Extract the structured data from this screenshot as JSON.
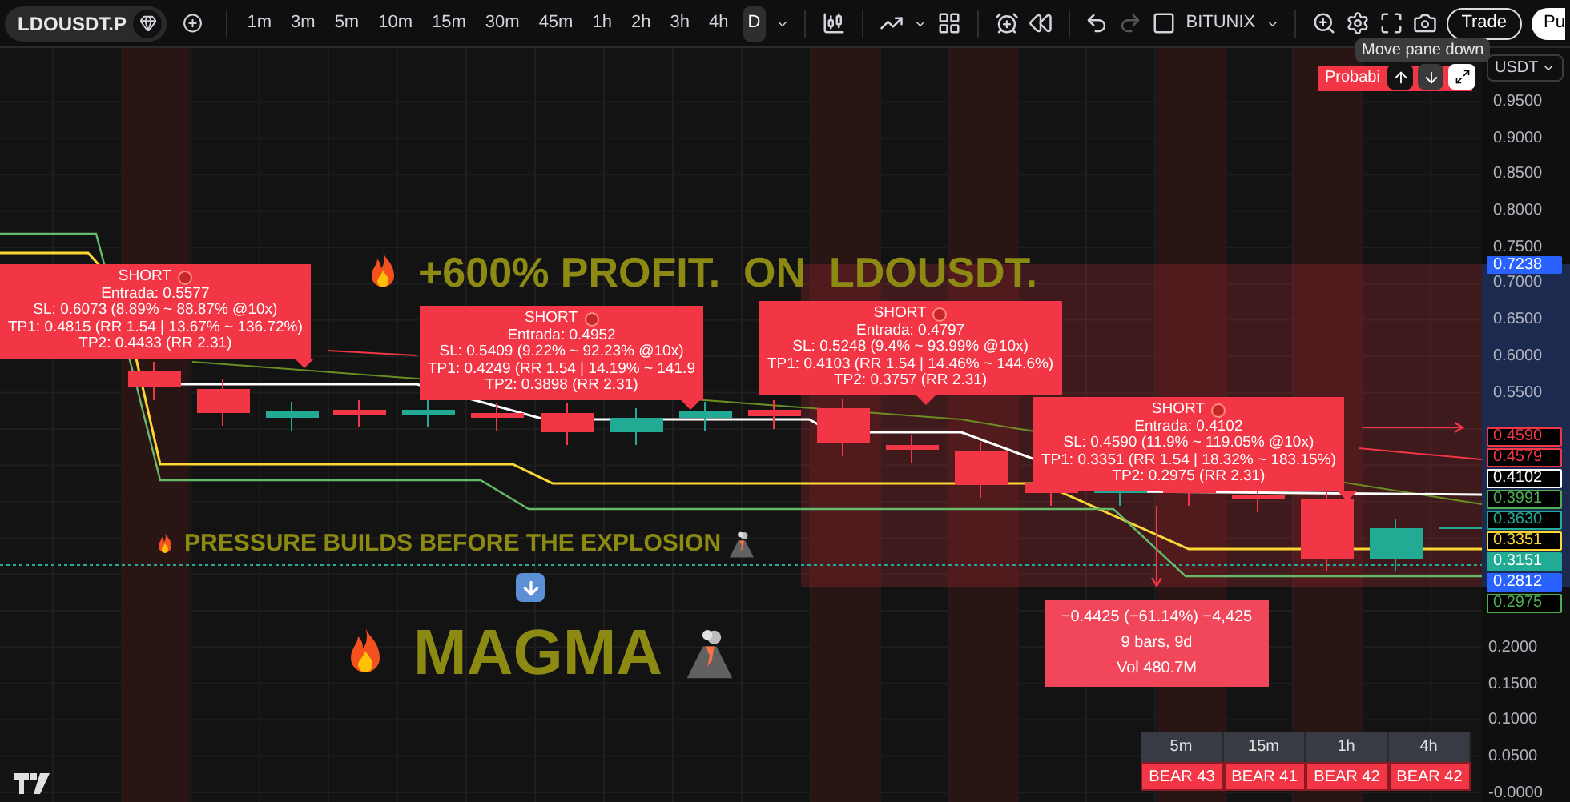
{
  "toolbar": {
    "symbol": "LDOUSDT.P",
    "intervals": [
      {
        "label": "1m",
        "selected": false
      },
      {
        "label": "3m",
        "selected": false
      },
      {
        "label": "5m",
        "selected": false
      },
      {
        "label": "10m",
        "selected": false
      },
      {
        "label": "15m",
        "selected": false
      },
      {
        "label": "30m",
        "selected": false
      },
      {
        "label": "45m",
        "selected": false
      },
      {
        "label": "1h",
        "selected": false
      },
      {
        "label": "2h",
        "selected": false
      },
      {
        "label": "3h",
        "selected": false
      },
      {
        "label": "4h",
        "selected": false
      },
      {
        "label": "D",
        "selected": true
      }
    ],
    "exchange": "BITUNIX",
    "trade_button": "Trade",
    "cut_button": "Pu"
  },
  "tooltip": "Move pane down",
  "pane": {
    "probability_label": "Probabi",
    "currency": "USDT"
  },
  "headline": "+600% PROFIT.  ON  LDOUSDT.",
  "subheadline": "PRESSURE BUILDS BEFORE THE EXPLOSION",
  "magma": "MAGMA",
  "signals": [
    {
      "title": "SHORT",
      "lines": [
        "Entrada: 0.5577",
        "SL: 0.6073 (8.89% ~ 88.87% @10x)",
        "TP1: 0.4815 (RR 1.54 | 13.67% ~ 136.72%)",
        "TP2: 0.4433 (RR 2.31)"
      ]
    },
    {
      "title": "SHORT",
      "lines": [
        "Entrada: 0.4952",
        "SL: 0.5409 (9.22% ~ 92.23% @10x)",
        "TP1: 0.4249 (RR 1.54 | 14.19% ~ 141.9",
        "TP2: 0.3898 (RR 2.31)"
      ]
    },
    {
      "title": "SHORT",
      "lines": [
        "Entrada: 0.4797",
        "SL: 0.5248 (9.4% ~ 93.99% @10x)",
        "TP1: 0.4103 (RR 1.54 | 14.46% ~ 144.6%)",
        "TP2: 0.3757 (RR 2.31)"
      ]
    },
    {
      "title": "SHORT",
      "lines": [
        "Entrada: 0.4102",
        "SL: 0.4590 (11.9% ~ 119.05% @10x)",
        "TP1: 0.3351 (RR 1.54 | 18.32% ~ 183.15%)",
        "TP2: 0.2975 (RR 2.31)"
      ]
    }
  ],
  "measure": [
    "−0.4425 (−61.14%) −4,425",
    "9 bars, 9d",
    "Vol 480.7M"
  ],
  "price_axis": {
    "upper": [
      "0.9500",
      "0.9000",
      "0.8500",
      "0.8000",
      "0.7500",
      "0.7000",
      "0.6500",
      "0.6000",
      "0.5500"
    ],
    "lower": [
      "0.2000",
      "0.1500",
      "0.1000",
      "0.0500",
      "-0.0000"
    ]
  },
  "top_tag": {
    "value": "0.7238",
    "kind": "filled",
    "color": "#2962ff"
  },
  "price_tags": [
    {
      "value": "0.4590",
      "kind": "outline",
      "color": "#f23645"
    },
    {
      "value": "0.4579",
      "kind": "outline",
      "color": "#f23645"
    },
    {
      "value": "0.4102",
      "kind": "outline",
      "color": "#ffffff"
    },
    {
      "value": "0.3991",
      "kind": "outline",
      "color": "#4caf50"
    },
    {
      "value": "0.3630",
      "kind": "outline",
      "color": "#22ab94"
    },
    {
      "value": "0.3351",
      "kind": "outline",
      "color": "#fdd835"
    },
    {
      "value": "0.3151",
      "kind": "filled",
      "color": "#22ab94"
    },
    {
      "value": "0.2812",
      "kind": "filled",
      "color": "#2962ff"
    },
    {
      "value": "0.2975",
      "kind": "outline",
      "color": "#4caf50"
    }
  ],
  "trend_table": {
    "columns": [
      "5m",
      "15m",
      "1h",
      "4h"
    ],
    "values": [
      "BEAR 43",
      "BEAR 41",
      "BEAR 42",
      "BEAR 42"
    ]
  }
}
